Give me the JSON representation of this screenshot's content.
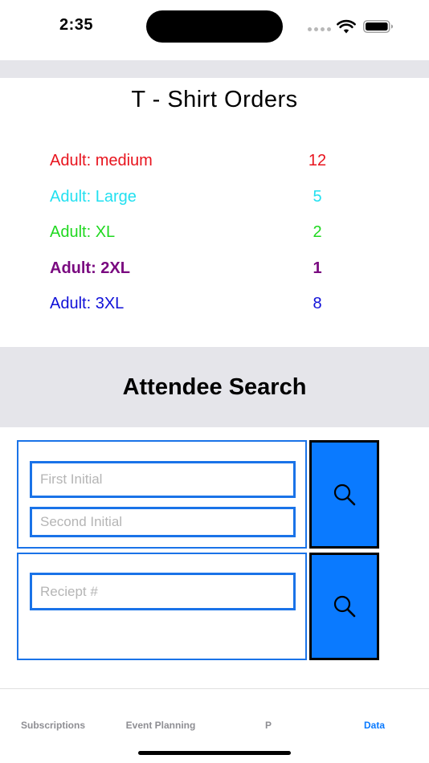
{
  "status": {
    "time": "2:35"
  },
  "orders": {
    "title": "T - Shirt Orders",
    "items": [
      {
        "label": "Adult: medium",
        "count": "12",
        "color": "#e8141e"
      },
      {
        "label": "Adult: Large",
        "count": "5",
        "color": "#22e0f0"
      },
      {
        "label": "Adult: XL",
        "count": "2",
        "color": "#1fd81f"
      },
      {
        "label": "Adult: 2XL",
        "count": "1",
        "color": "#7a0a80"
      },
      {
        "label": "Adult: 3XL",
        "count": "8",
        "color": "#1010d8"
      }
    ]
  },
  "attendee_search": {
    "title": "Attendee Search",
    "first_initial_placeholder": "First Initial",
    "second_initial_placeholder": "Second Initial",
    "receipt_placeholder": "Reciept #"
  },
  "tabs": [
    {
      "label": "Subscriptions",
      "active": false
    },
    {
      "label": "Event Planning",
      "active": false
    },
    {
      "label": "P",
      "active": false
    },
    {
      "label": "Data",
      "active": true
    }
  ],
  "colors": {
    "accent": "#0a7aff",
    "border": "#1a73e8",
    "header_gray": "#e5e5ea"
  },
  "icons": [
    "wifi-icon",
    "battery-icon",
    "search-icon"
  ]
}
